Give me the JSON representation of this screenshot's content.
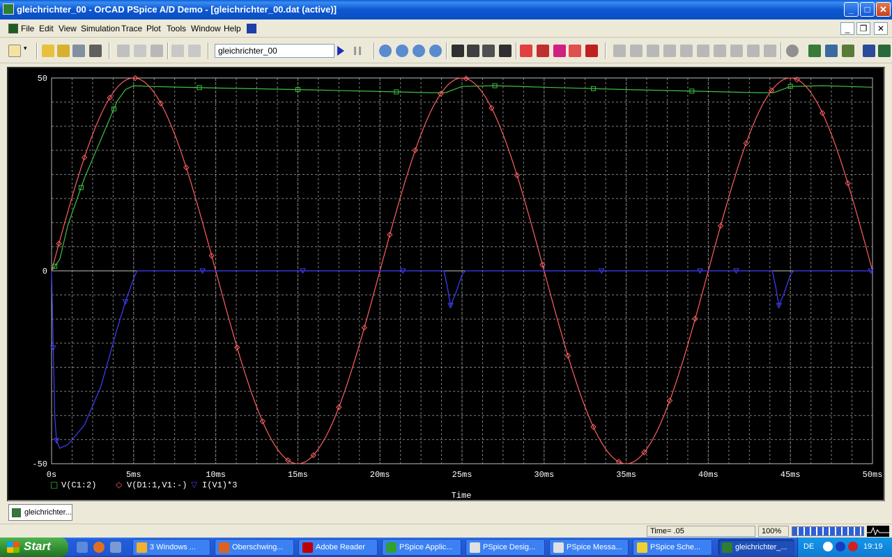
{
  "window": {
    "title": "gleichrichter_00 - OrCAD PSpice A/D Demo  - [gleichrichter_00.dat (active)]",
    "buttons": {
      "minimize": "_",
      "maximize": "□",
      "close": "✕"
    }
  },
  "menu": {
    "items": [
      "File",
      "Edit",
      "View",
      "Simulation",
      "Trace",
      "Plot",
      "Tools",
      "Window",
      "Help"
    ],
    "mdi_buttons": {
      "minimize": "_",
      "restore": "❐",
      "close": "✕"
    }
  },
  "toolbar": {
    "profile_value": "gleichrichter_00"
  },
  "plot": {
    "xlabel": "Time",
    "x_ticks": [
      "0s",
      "5ms",
      "10ms",
      "15ms",
      "20ms",
      "25ms",
      "30ms",
      "35ms",
      "40ms",
      "45ms",
      "50ms"
    ],
    "y_ticks": [
      "50",
      "0",
      "-50"
    ],
    "legend": [
      {
        "marker": "□",
        "name": "V(C1:2)",
        "color": "#40c040"
      },
      {
        "marker": "◇",
        "name": "V(D1:1,V1:-)",
        "color": "#ff6060"
      },
      {
        "marker": "▽",
        "name": "I(V1)*3",
        "color": "#4040ff"
      }
    ]
  },
  "chart_data": {
    "type": "line",
    "xlabel": "Time",
    "ylabel": "",
    "xunit": "ms",
    "xlim": [
      0,
      50
    ],
    "ylim": [
      -50,
      50
    ],
    "grid": true,
    "legend_position": "bottom-left",
    "series": [
      {
        "name": "V(C1:2)",
        "color": "#40c040",
        "marker": "square",
        "points": [
          [
            0,
            0
          ],
          [
            0.5,
            3
          ],
          [
            1,
            12
          ],
          [
            2,
            24
          ],
          [
            3,
            34
          ],
          [
            4,
            44
          ],
          [
            4.5,
            47
          ],
          [
            5,
            48
          ],
          [
            6,
            47.8
          ],
          [
            10,
            47.4
          ],
          [
            15,
            47
          ],
          [
            20,
            46.5
          ],
          [
            23,
            46.2
          ],
          [
            24,
            46.2
          ],
          [
            25,
            47.8
          ],
          [
            27,
            48
          ],
          [
            30,
            47.6
          ],
          [
            35,
            47
          ],
          [
            40,
            46.5
          ],
          [
            43,
            46.2
          ],
          [
            44,
            46.2
          ],
          [
            45,
            47.8
          ],
          [
            47,
            48
          ],
          [
            50,
            47.6
          ]
        ]
      },
      {
        "name": "V(D1:1,V1:-)",
        "color": "#ff6060",
        "marker": "diamond",
        "amplitude": 50,
        "period_ms": 20,
        "waveform": "sine"
      },
      {
        "name": "I(V1)*3",
        "color": "#4040ff",
        "marker": "triangle-down",
        "points": [
          [
            0,
            0
          ],
          [
            0.1,
            -20
          ],
          [
            0.2,
            -38
          ],
          [
            0.3,
            -44
          ],
          [
            0.5,
            -46
          ],
          [
            1,
            -45
          ],
          [
            2,
            -40
          ],
          [
            3,
            -30
          ],
          [
            4,
            -15
          ],
          [
            4.5,
            -8
          ],
          [
            5,
            -2
          ],
          [
            5.2,
            0
          ],
          [
            23.9,
            0
          ],
          [
            24.1,
            -4
          ],
          [
            24.3,
            -9
          ],
          [
            24.6,
            -6
          ],
          [
            25,
            -1
          ],
          [
            25.2,
            0
          ],
          [
            43.9,
            0
          ],
          [
            44.1,
            -4
          ],
          [
            44.3,
            -9
          ],
          [
            44.6,
            -6
          ],
          [
            45,
            -1
          ],
          [
            45.2,
            0
          ],
          [
            50,
            0
          ]
        ]
      }
    ]
  },
  "wintabs": {
    "tab_label": "gleichrichter..."
  },
  "status": {
    "time": "Time= .05",
    "zoom": "100%",
    "progress": 1.0
  },
  "taskbar": {
    "start": "Start",
    "tasks": [
      {
        "label": "3 Windows ...",
        "color": "#f0b030"
      },
      {
        "label": "Oberschwing...",
        "color": "#e06020"
      },
      {
        "label": "Adobe Reader",
        "color": "#c00000"
      },
      {
        "label": "PSpice Applic...",
        "color": "#30a030"
      },
      {
        "label": "PSpice Desig...",
        "color": "#e0e0e0"
      },
      {
        "label": "PSpice Messa...",
        "color": "#e0e0e0"
      },
      {
        "label": "PSpice Sche...",
        "color": "#f0d030"
      },
      {
        "label": "gleichrichter_...",
        "color": "#2e7d32"
      }
    ],
    "lang": "DE",
    "clock": "19:19"
  }
}
